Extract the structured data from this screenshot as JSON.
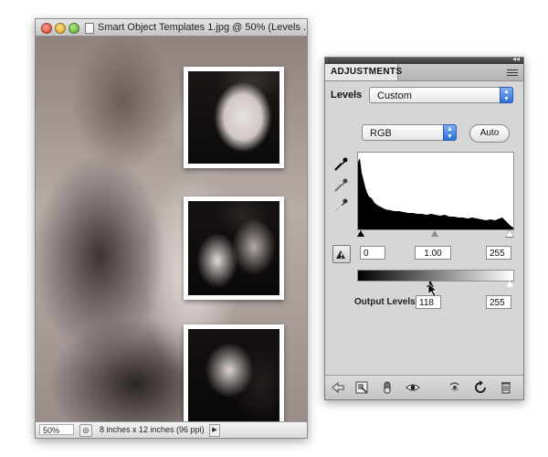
{
  "document": {
    "title": "Smart Object Templates 1.jpg @ 50% (Levels ...",
    "zoom": "50%",
    "info": "8 inches x 12 inches (96 ppi)",
    "photo_icon": "couple-photo"
  },
  "adjustments": {
    "tab_label": "ADJUSTMENTS",
    "section_label": "Levels",
    "preset_value": "Custom",
    "channel_value": "RGB",
    "auto_label": "Auto",
    "input_black": "0",
    "input_gamma": "1.00",
    "input_white": "255",
    "output_label": "Output Levels:",
    "output_black": "118",
    "output_white": "255",
    "colors": {
      "accent_blue": "#2d6ed9"
    },
    "icons": [
      "black-point-eyedropper",
      "gray-point-eyedropper",
      "white-point-eyedropper",
      "clipping-warning",
      "back-arrow",
      "clip-to-layer",
      "layer-visibility",
      "view-previous",
      "reset",
      "delete"
    ]
  }
}
